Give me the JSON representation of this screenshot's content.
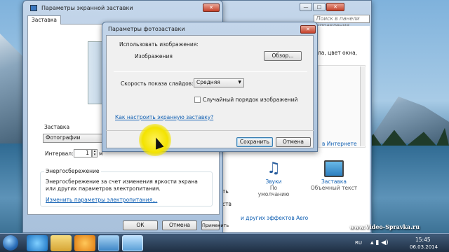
{
  "screensaver_window": {
    "title": "Параметры экранной заставки",
    "tab": "Заставка",
    "screensaver_label": "Заставка",
    "screensaver_value": "Фотографии",
    "interval_label": "Интервал:",
    "interval_value": "1",
    "interval_unit": "м",
    "power_title": "Энергосбережение",
    "power_text": "Энергосбережение за счет изменения яркости экрана или других параметров электропитания.",
    "power_link": "Изменить параметры электропитания...",
    "ok": "ОК",
    "cancel": "Отмена",
    "apply": "Применить"
  },
  "photo_dialog": {
    "title": "Параметры фотозаставки",
    "use_images": "Использовать изображения:",
    "images_label": "Изображения",
    "browse": "Обзор...",
    "speed_label": "Скорость показа слайдов:",
    "speed_value": "Средняя",
    "shuffle_label": "Случайный порядок изображений",
    "help_link": "Как настроить экранную заставку?",
    "save": "Сохранить",
    "cancel": "Отмена"
  },
  "personalization": {
    "search_placeholder": "Поиск в панели управления",
    "partial_text": "ла, цвет окна,",
    "internet_text": "в Интернете",
    "link1": "и других эффектов Aero",
    "item_sounds_title": "Звуки",
    "item_sounds_sub": "По умолчанию",
    "item_saver_title": "Заставка",
    "item_saver_sub": "Объемный текст",
    "fragment_a": "т",
    "fragment_b": "ть",
    "fragment_c": "ств"
  },
  "taskbar": {
    "lang": "RU",
    "time": "15:45",
    "date": "06.03.2014"
  },
  "watermark": "www.Video-Spravka.ru"
}
